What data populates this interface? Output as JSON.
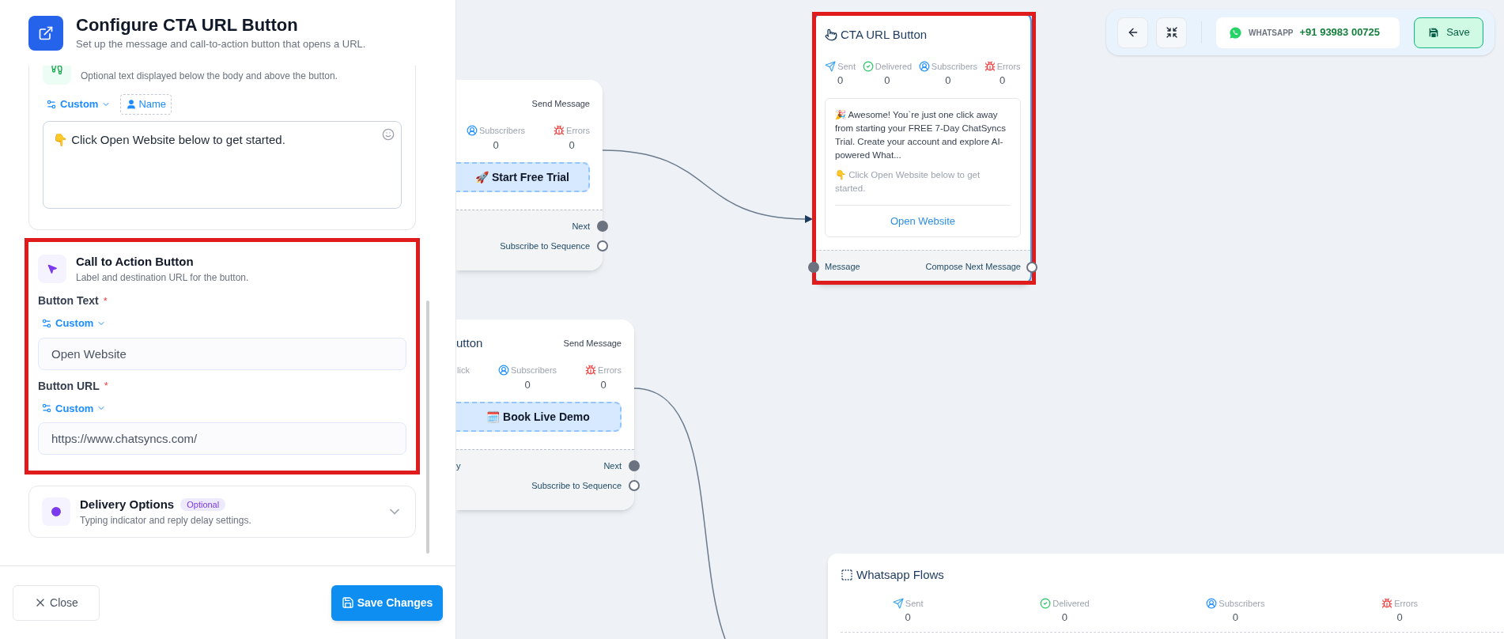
{
  "panel": {
    "title": "Configure CTA URL Button",
    "subtitle": "Set up the message and call-to-action button that opens a URL.",
    "footer_card": {
      "description": "Optional text displayed below the body and above the button.",
      "chips": [
        {
          "kind": "custom",
          "label": "Custom"
        },
        {
          "kind": "name",
          "label": "Name"
        }
      ],
      "value": "👇 Click Open Website below to get started."
    },
    "cta_card": {
      "title": "Call to Action Button",
      "description": "Label and destination URL for the button.",
      "fields": [
        {
          "label": "Button Text",
          "required_mark": "*",
          "variable": "Custom",
          "value": "Open Website"
        },
        {
          "label": "Button URL",
          "required_mark": "*",
          "variable": "Custom",
          "value": "https://www.chatsyncs.com/"
        }
      ]
    },
    "delivery_card": {
      "title": "Delivery Options",
      "badge": "Optional",
      "description": "Typing indicator and reply delay settings.",
      "expanded": false
    },
    "buttons": [
      {
        "kind": "close",
        "label": "Close"
      },
      {
        "kind": "save",
        "label": "Save Changes"
      }
    ]
  },
  "toolbar": {
    "channel": "WHATSAPP",
    "phone": "+91 93983 00725",
    "save": "Save"
  },
  "nodes": [
    {
      "type_label": "Send Message",
      "stats": [
        {
          "kind": "subscribers",
          "label": "Subscribers",
          "value": "0"
        },
        {
          "kind": "errors",
          "label": "Errors",
          "value": "0"
        }
      ],
      "button": "🚀 Start Free Trial",
      "outputs": [
        {
          "label": "Next",
          "connected": true
        },
        {
          "label": "Subscribe to Sequence",
          "connected": false
        }
      ]
    },
    {
      "title": "utton",
      "type_label": "Send Message",
      "stats": [
        {
          "kind": "click",
          "label": "lick"
        },
        {
          "kind": "subscribers",
          "label": "Subscribers",
          "value": "0"
        },
        {
          "kind": "errors",
          "label": "Errors",
          "value": "0"
        }
      ],
      "button": "🗓️ Book Live Demo",
      "left_output": "y",
      "outputs": [
        {
          "label": "Next",
          "connected": true
        },
        {
          "label": "Subscribe to Sequence",
          "connected": false
        }
      ]
    }
  ],
  "cta_node": {
    "title": "CTA URL Button",
    "stats": [
      {
        "kind": "sent",
        "label": "Sent",
        "value": "0"
      },
      {
        "kind": "delivered",
        "label": "Delivered",
        "value": "0"
      },
      {
        "kind": "subscribers",
        "label": "Subscribers",
        "value": "0"
      },
      {
        "kind": "errors",
        "label": "Errors",
        "value": "0"
      }
    ],
    "body": "🎉 Awesome! You`re just one click away from starting your FREE 7-Day ChatSyncs Trial. Create your account and explore AI-powered What...",
    "footer": "👇 Click Open Website below to get started.",
    "link": "Open Website",
    "input": "Message",
    "output": "Compose Next Message",
    "selected": true
  },
  "flows_node": {
    "title": "Whatsapp Flows",
    "stats": [
      {
        "kind": "sent",
        "label": "Sent",
        "value": "0"
      },
      {
        "kind": "delivered",
        "label": "Delivered",
        "value": "0"
      },
      {
        "kind": "subscribers",
        "label": "Subscribers",
        "value": "0"
      },
      {
        "kind": "errors",
        "label": "Errors",
        "value": "0"
      }
    ]
  }
}
